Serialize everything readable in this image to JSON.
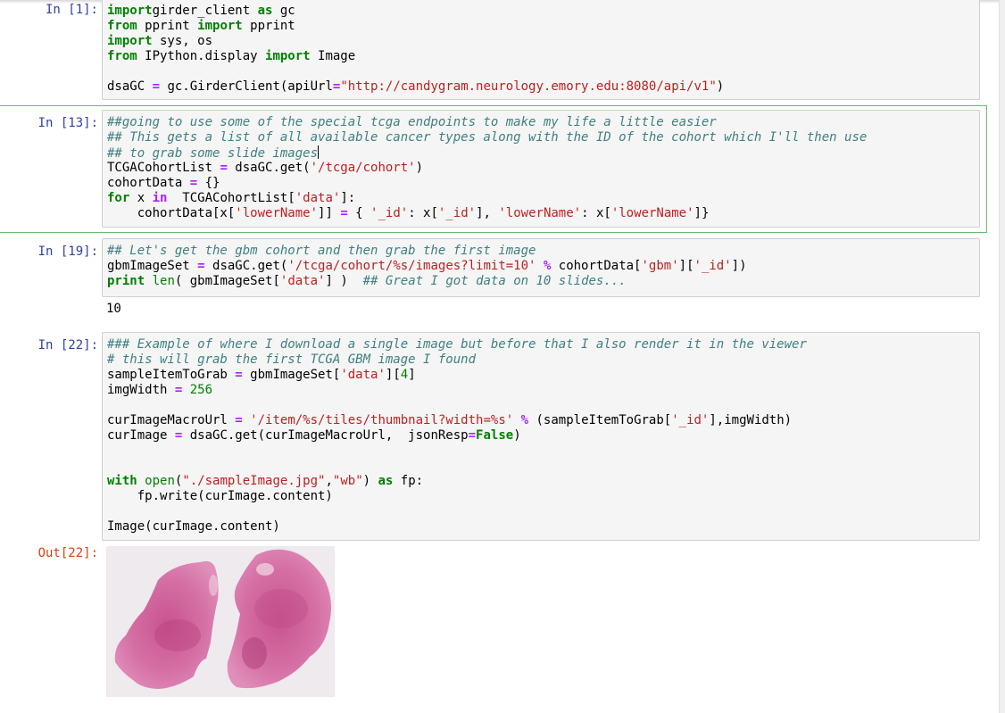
{
  "cells": [
    {
      "prompt": "In [1]:",
      "lines": [
        [
          [
            "kw",
            "import"
          ],
          [
            "",
            "girder_client "
          ],
          [
            "kw",
            "as"
          ],
          [
            "",
            " gc"
          ]
        ],
        [
          [
            "kw",
            "from"
          ],
          [
            "",
            " pprint "
          ],
          [
            "kw",
            "import"
          ],
          [
            "",
            " pprint"
          ]
        ],
        [
          [
            "kw",
            "import"
          ],
          [
            "",
            " sys, os"
          ]
        ],
        [
          [
            "kw",
            "from"
          ],
          [
            "",
            " IPython.display "
          ],
          [
            "kw",
            "import"
          ],
          [
            "",
            " Image"
          ]
        ],
        [],
        [
          [
            "",
            "dsaGC "
          ],
          [
            "op",
            "="
          ],
          [
            "",
            " gc.GirderClient(apiUrl"
          ],
          [
            "op",
            "="
          ],
          [
            "str",
            "\"http://candygram.neurology.emory.edu:8080/api/v1\""
          ],
          [
            "",
            ")"
          ]
        ]
      ]
    },
    {
      "prompt": "In [13]:",
      "lines": [
        [
          [
            "cm",
            "##going to use some of the special tcga endpoints to make my life a little easier"
          ]
        ],
        [
          [
            "cm",
            "## This gets a list of all available cancer types along with the ID of the cohort which I'll then use"
          ]
        ],
        [
          [
            "cm",
            "## to grab some slide images"
          ]
        ],
        [
          [
            "",
            "TCGACohortList "
          ],
          [
            "op",
            "="
          ],
          [
            "",
            " dsaGC.get("
          ],
          [
            "str",
            "'/tcga/cohort'"
          ],
          [
            "",
            ")"
          ]
        ],
        [
          [
            "",
            "cohortData "
          ],
          [
            "op",
            "="
          ],
          [
            "",
            " {}"
          ]
        ],
        [
          [
            "kw",
            "for"
          ],
          [
            "",
            " x "
          ],
          [
            "op",
            "in"
          ],
          [
            "",
            "  TCGACohortList["
          ],
          [
            "str",
            "'data'"
          ],
          [
            "",
            "]:"
          ]
        ],
        [
          [
            "",
            "    cohortData[x["
          ],
          [
            "str",
            "'lowerName'"
          ],
          [
            "",
            "]] "
          ],
          [
            "op",
            "="
          ],
          [
            "",
            " { "
          ],
          [
            "str",
            "'_id'"
          ],
          [
            "",
            ": x["
          ],
          [
            "str",
            "'_id'"
          ],
          [
            "",
            "], "
          ],
          [
            "str",
            "'lowerName'"
          ],
          [
            "",
            ": x["
          ],
          [
            "str",
            "'lowerName'"
          ],
          [
            "",
            "]}"
          ]
        ]
      ]
    },
    {
      "prompt": "In [19]:",
      "lines": [
        [
          [
            "cm",
            "## Let's get the gbm cohort and then grab the first image"
          ]
        ],
        [
          [
            "",
            "gbmImageSet "
          ],
          [
            "op",
            "="
          ],
          [
            "",
            " dsaGC.get("
          ],
          [
            "str",
            "'/tcga/cohort/%s/images?limit=10'"
          ],
          [
            "",
            " "
          ],
          [
            "op",
            "%"
          ],
          [
            "",
            " cohortData["
          ],
          [
            "str",
            "'gbm'"
          ],
          [
            "",
            "]["
          ],
          [
            "str",
            "'_id'"
          ],
          [
            "",
            "])"
          ]
        ],
        [
          [
            "kw",
            "print"
          ],
          [
            "",
            " "
          ],
          [
            "bi",
            "len"
          ],
          [
            "",
            "( gbmImageSet["
          ],
          [
            "str",
            "'data'"
          ],
          [
            "",
            "] )  "
          ],
          [
            "cm",
            "## Great I got data on 10 slides..."
          ]
        ]
      ],
      "output": "10"
    },
    {
      "prompt": "In [22]:",
      "lines": [
        [
          [
            "cm",
            "### Example of where I download a single image but before that I also render it in the viewer"
          ]
        ],
        [
          [
            "cm",
            "# this will grab the first TCGA GBM image I found"
          ]
        ],
        [
          [
            "",
            "sampleItemToGrab "
          ],
          [
            "op",
            "="
          ],
          [
            "",
            " gbmImageSet["
          ],
          [
            "str",
            "'data'"
          ],
          [
            "",
            "]["
          ],
          [
            "num",
            "4"
          ],
          [
            "",
            "]"
          ]
        ],
        [
          [
            "",
            "imgWidth "
          ],
          [
            "op",
            "="
          ],
          [
            "",
            " "
          ],
          [
            "num",
            "256"
          ]
        ],
        [],
        [
          [
            "",
            "curImageMacroUrl "
          ],
          [
            "op",
            "="
          ],
          [
            "",
            " "
          ],
          [
            "str",
            "'/item/%s/tiles/thumbnail?width=%s'"
          ],
          [
            "",
            " "
          ],
          [
            "op",
            "%"
          ],
          [
            "",
            " (sampleItemToGrab["
          ],
          [
            "str",
            "'_id'"
          ],
          [
            "",
            "],imgWidth)"
          ]
        ],
        [
          [
            "",
            "curImage "
          ],
          [
            "op",
            "="
          ],
          [
            "",
            " dsaGC.get(curImageMacroUrl,  jsonResp"
          ],
          [
            "op",
            "="
          ],
          [
            "kw",
            "False"
          ],
          [
            "",
            ")"
          ]
        ],
        [],
        [],
        [
          [
            "kw",
            "with"
          ],
          [
            "",
            " "
          ],
          [
            "bi",
            "open"
          ],
          [
            "",
            "("
          ],
          [
            "str",
            "\"./sampleImage.jpg\""
          ],
          [
            "",
            ","
          ],
          [
            "str",
            "\"wb\""
          ],
          [
            "",
            ") "
          ],
          [
            "kw",
            "as"
          ],
          [
            "",
            " fp:"
          ]
        ],
        [
          [
            "",
            "    fp.write(curImage.content)"
          ]
        ],
        [],
        [
          [
            "",
            "Image(curImage.content)"
          ]
        ]
      ],
      "out_prompt": "Out[22]:"
    }
  ]
}
